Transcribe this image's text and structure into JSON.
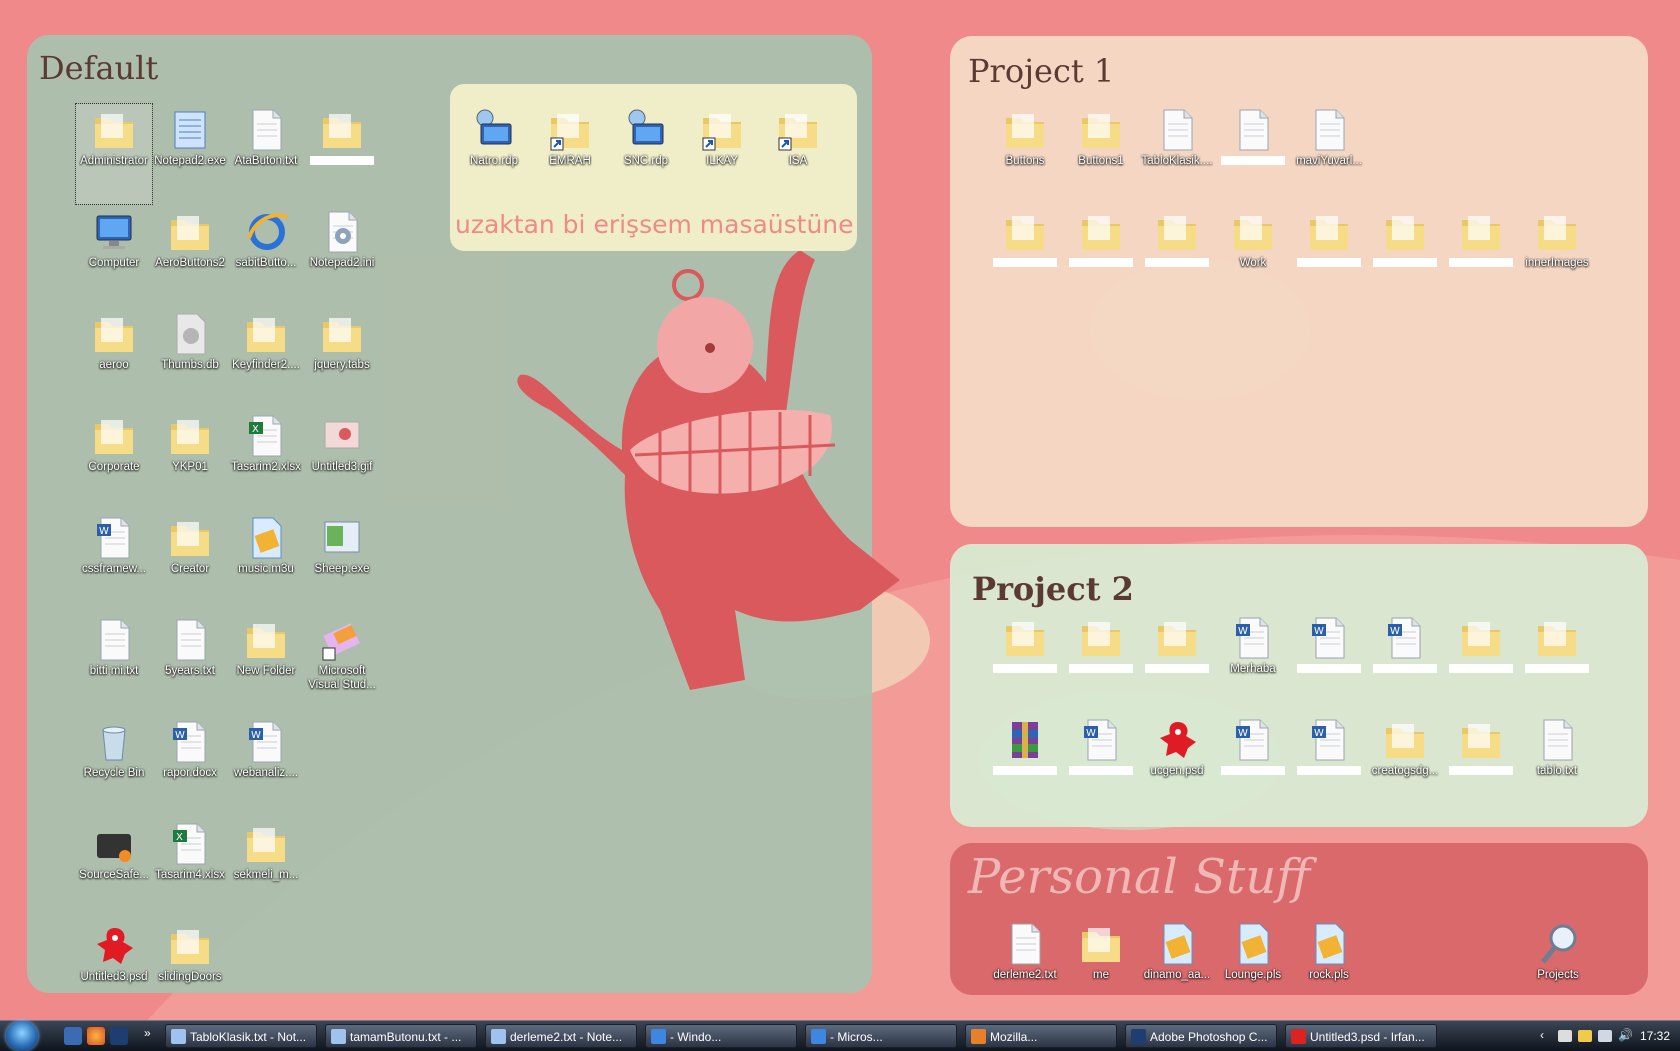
{
  "panels": {
    "default": {
      "title": "Default"
    },
    "remote": {
      "caption": "uzaktan bi erişsem  masaüstüne"
    },
    "project1": {
      "title": "Project 1"
    },
    "project2": {
      "title": "Project 2"
    },
    "personal": {
      "title": "Personal Stuff"
    }
  },
  "default_icons": [
    {
      "label": "Administrator",
      "icon": "folder-user-icon"
    },
    {
      "label": "Notepad2.exe",
      "icon": "notepad-icon"
    },
    {
      "label": "AtaButon.txt",
      "icon": "text-file-icon"
    },
    {
      "label": "",
      "icon": "folder-icon",
      "redacted": true
    },
    {
      "label": "Computer",
      "icon": "computer-icon"
    },
    {
      "label": "AeroButtons2",
      "icon": "folder-icon"
    },
    {
      "label": "sabitButto...",
      "icon": "ie-icon"
    },
    {
      "label": "Notepad2.ini",
      "icon": "settings-file-icon"
    },
    {
      "label": "aeroo",
      "icon": "folder-icon"
    },
    {
      "label": "Thumbs.db",
      "icon": "db-file-icon"
    },
    {
      "label": "Keyfinder2....",
      "icon": "folder-icon"
    },
    {
      "label": "jquery.tabs",
      "icon": "folder-icon"
    },
    {
      "label": "Corporate",
      "icon": "folder-icon"
    },
    {
      "label": "YKP01",
      "icon": "folder-icon"
    },
    {
      "label": "Tasarim2.xlsx",
      "icon": "excel-icon"
    },
    {
      "label": "Untitled3.gif",
      "icon": "image-icon"
    },
    {
      "label": "cssframew...",
      "icon": "word-icon"
    },
    {
      "label": "Creator",
      "icon": "folder-icon"
    },
    {
      "label": "music.m3u",
      "icon": "playlist-icon"
    },
    {
      "label": "Sheep.exe",
      "icon": "app-icon"
    },
    {
      "label": "bitti mi.txt",
      "icon": "text-file-icon"
    },
    {
      "label": "5years.txt",
      "icon": "text-file-icon"
    },
    {
      "label": "New Folder",
      "icon": "folder-icon"
    },
    {
      "label": "Microsoft Visual Stud...",
      "icon": "visual-studio-icon"
    },
    {
      "label": "Recycle Bin",
      "icon": "recycle-bin-icon"
    },
    {
      "label": "rapor.docx",
      "icon": "word-icon"
    },
    {
      "label": "webanaliz....",
      "icon": "word-icon"
    },
    {
      "label": "",
      "icon": "none"
    },
    {
      "label": "SourceSafe...",
      "icon": "sourcesafe-icon"
    },
    {
      "label": "Tasarim4.xlsx",
      "icon": "excel-icon"
    },
    {
      "label": "sekmeli_m...",
      "icon": "folder-icon"
    },
    {
      "label": "",
      "icon": "none"
    },
    {
      "label": "Untitled3.psd",
      "icon": "psd-icon"
    },
    {
      "label": "slidingDoors",
      "icon": "folder-icon"
    }
  ],
  "remote_icons": [
    {
      "label": "Natro.rdp",
      "icon": "remote-desktop-icon"
    },
    {
      "label": "EMRAH",
      "icon": "folder-shortcut-icon"
    },
    {
      "label": "SNC.rdp",
      "icon": "remote-desktop-icon"
    },
    {
      "label": "ILKAY",
      "icon": "folder-shortcut-icon"
    },
    {
      "label": "ISA",
      "icon": "folder-shortcut-icon"
    }
  ],
  "project1_icons": [
    {
      "label": "Buttons",
      "icon": "folder-icon",
      "redacted": true
    },
    {
      "label": "Buttons1",
      "icon": "folder-icon",
      "redacted": true
    },
    {
      "label": "TabloKlasik....",
      "icon": "text-file-icon"
    },
    {
      "label": "",
      "icon": "text-file-icon",
      "redacted": true
    },
    {
      "label": "maviYuvarl...",
      "icon": "text-file-icon"
    },
    {
      "label": "",
      "icon": "folder-icon",
      "redacted": true
    },
    {
      "label": "",
      "icon": "folder-icon",
      "redacted": true
    },
    {
      "label": "",
      "icon": "folder-icon",
      "redacted": true
    },
    {
      "label": "Work",
      "icon": "folder-icon"
    },
    {
      "label": "",
      "icon": "folder-icon",
      "redacted": true
    },
    {
      "label": "",
      "icon": "folder-icon",
      "redacted": true
    },
    {
      "label": "",
      "icon": "folder-icon",
      "redacted": true
    },
    {
      "label": "innerImages",
      "icon": "folder-icon"
    }
  ],
  "project2_icons": [
    {
      "label": "",
      "icon": "folder-icon",
      "redacted": true
    },
    {
      "label": "",
      "icon": "folder-icon",
      "redacted": true
    },
    {
      "label": "",
      "icon": "folder-icon",
      "redacted": true
    },
    {
      "label": "Merhaba",
      "icon": "word-icon",
      "redacted": true
    },
    {
      "label": "",
      "icon": "word-icon",
      "redacted": true
    },
    {
      "label": "",
      "icon": "word-icon",
      "redacted": true
    },
    {
      "label": "",
      "icon": "folder-icon",
      "redacted": true
    },
    {
      "label": "",
      "icon": "folder-icon",
      "redacted": true
    },
    {
      "label": "",
      "icon": "winrar-icon",
      "redacted": true
    },
    {
      "label": "",
      "icon": "word-icon",
      "redacted": true
    },
    {
      "label": "ucgen.psd",
      "icon": "psd-icon"
    },
    {
      "label": "",
      "icon": "word-icon",
      "redacted": true
    },
    {
      "label": "",
      "icon": "word-icon",
      "redacted": true
    },
    {
      "label": "creatogsdg...",
      "icon": "folder-icon"
    },
    {
      "label": "",
      "icon": "folder-icon",
      "redacted": true
    },
    {
      "label": "tablo.txt",
      "icon": "text-file-icon"
    }
  ],
  "personal_icons": [
    {
      "label": "derleme2.txt",
      "icon": "text-file-icon"
    },
    {
      "label": "me",
      "icon": "folder-icon"
    },
    {
      "label": "dinamo_aa...",
      "icon": "playlist-icon"
    },
    {
      "label": "Lounge.pls",
      "icon": "playlist-icon"
    },
    {
      "label": "rock.pls",
      "icon": "playlist-icon"
    },
    {
      "label": "Projects",
      "icon": "search-icon"
    }
  ],
  "taskbar": {
    "tasks": [
      {
        "label": "TabloKlasik.txt - Not...",
        "icon": "notepad-icon"
      },
      {
        "label": "tamamButonu.txt - ...",
        "icon": "notepad-icon"
      },
      {
        "label": "derleme2.txt - Note...",
        "icon": "notepad-icon"
      },
      {
        "label": "- Windo...",
        "icon": "ie-icon"
      },
      {
        "label": "- Micros...",
        "icon": "ie-icon"
      },
      {
        "label": "Mozilla...",
        "icon": "firefox-icon"
      },
      {
        "label": "Adobe Photoshop C...",
        "icon": "photoshop-icon"
      },
      {
        "label": "Untitled3.psd - Irfan...",
        "icon": "irfanview-icon"
      }
    ],
    "clock": "17:32"
  },
  "colors": {
    "wallpaper": "#f0898a",
    "default_panel": "#a9c2ae",
    "remote_panel": "#f3f0c9",
    "project1_panel": "#f4dcc6",
    "project2_panel": "#d8ecd3",
    "personal_panel": "#d9676a",
    "caption": "#ef8a8a"
  }
}
